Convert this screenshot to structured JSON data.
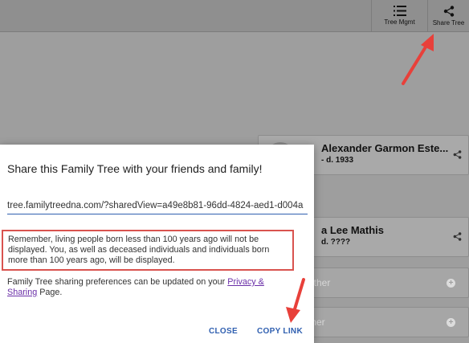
{
  "toolbar": {
    "tree_mgmt_label": "Tree Mgmt",
    "share_tree_label": "Share Tree"
  },
  "cards": [
    {
      "name": "Alexander Garmon Este...",
      "dates": "- d. 1933"
    },
    {
      "name": "a Lee Mathis",
      "dates": "d. ????"
    }
  ],
  "add_cards": [
    {
      "label": "ather"
    },
    {
      "label": "ther"
    }
  ],
  "dialog": {
    "title": "Share this Family Tree with your friends and family!",
    "link_value": "tree.familytreedna.com/?sharedView=a49e8b81-96dd-4824-aed1-d004a",
    "notice": "Remember, living people born less than 100 years ago will not be displayed. You, as well as deceased individuals and individuals born more than 100 years ago, will be displayed.",
    "prefs_before": "Family Tree sharing preferences can be updated on your ",
    "prefs_link": "Privacy & Sharing",
    "prefs_after": " Page.",
    "close_label": "CLOSE",
    "copy_label": "COPY LINK"
  },
  "colors": {
    "accent": "#2f5fb0",
    "highlight_border": "#d9534f",
    "annotation_arrow": "#e8403a",
    "link": "#6a2fa8"
  }
}
